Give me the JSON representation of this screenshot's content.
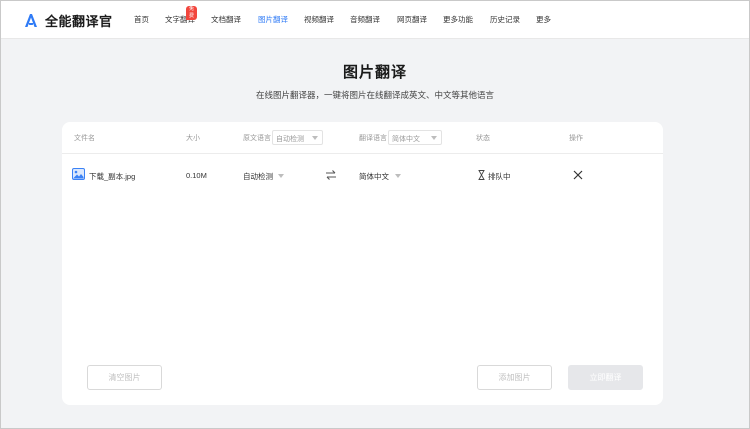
{
  "header": {
    "logo_text": "全能翻译官",
    "nav": [
      {
        "label": "首页",
        "active": false
      },
      {
        "label": "文字翻译",
        "active": false,
        "badge": "免费"
      },
      {
        "label": "文档翻译",
        "active": false
      },
      {
        "label": "图片翻译",
        "active": true
      },
      {
        "label": "视频翻译",
        "active": false
      },
      {
        "label": "音频翻译",
        "active": false
      },
      {
        "label": "网页翻译",
        "active": false
      },
      {
        "label": "更多功能",
        "active": false
      },
      {
        "label": "历史记录",
        "active": false
      },
      {
        "label": "更多",
        "active": false
      }
    ]
  },
  "page": {
    "title": "图片翻译",
    "subtitle": "在线图片翻译器，一键将图片在线翻译成英文、中文等其他语言"
  },
  "table": {
    "headers": {
      "filename": "文件名",
      "size": "大小",
      "source_lang": "原文语言",
      "target_lang": "翻译语言",
      "status": "状态",
      "action": "操作"
    },
    "source_select": "自动检测",
    "target_select": "简体中文",
    "rows": [
      {
        "filename": "下载_副本.jpg",
        "size": "0.10M",
        "source_lang": "自动检测",
        "target_lang": "简体中文",
        "status": "排队中"
      }
    ]
  },
  "buttons": {
    "clear": "清空图片",
    "add": "添加图片",
    "translate": "立即翻译"
  },
  "colors": {
    "accent": "#2f7bf6",
    "badge": "#f2463d",
    "background": "#f2f3f5"
  },
  "icons": [
    "logo-icon",
    "image-file-icon",
    "swap-icon",
    "hourglass-icon",
    "close-icon"
  ]
}
